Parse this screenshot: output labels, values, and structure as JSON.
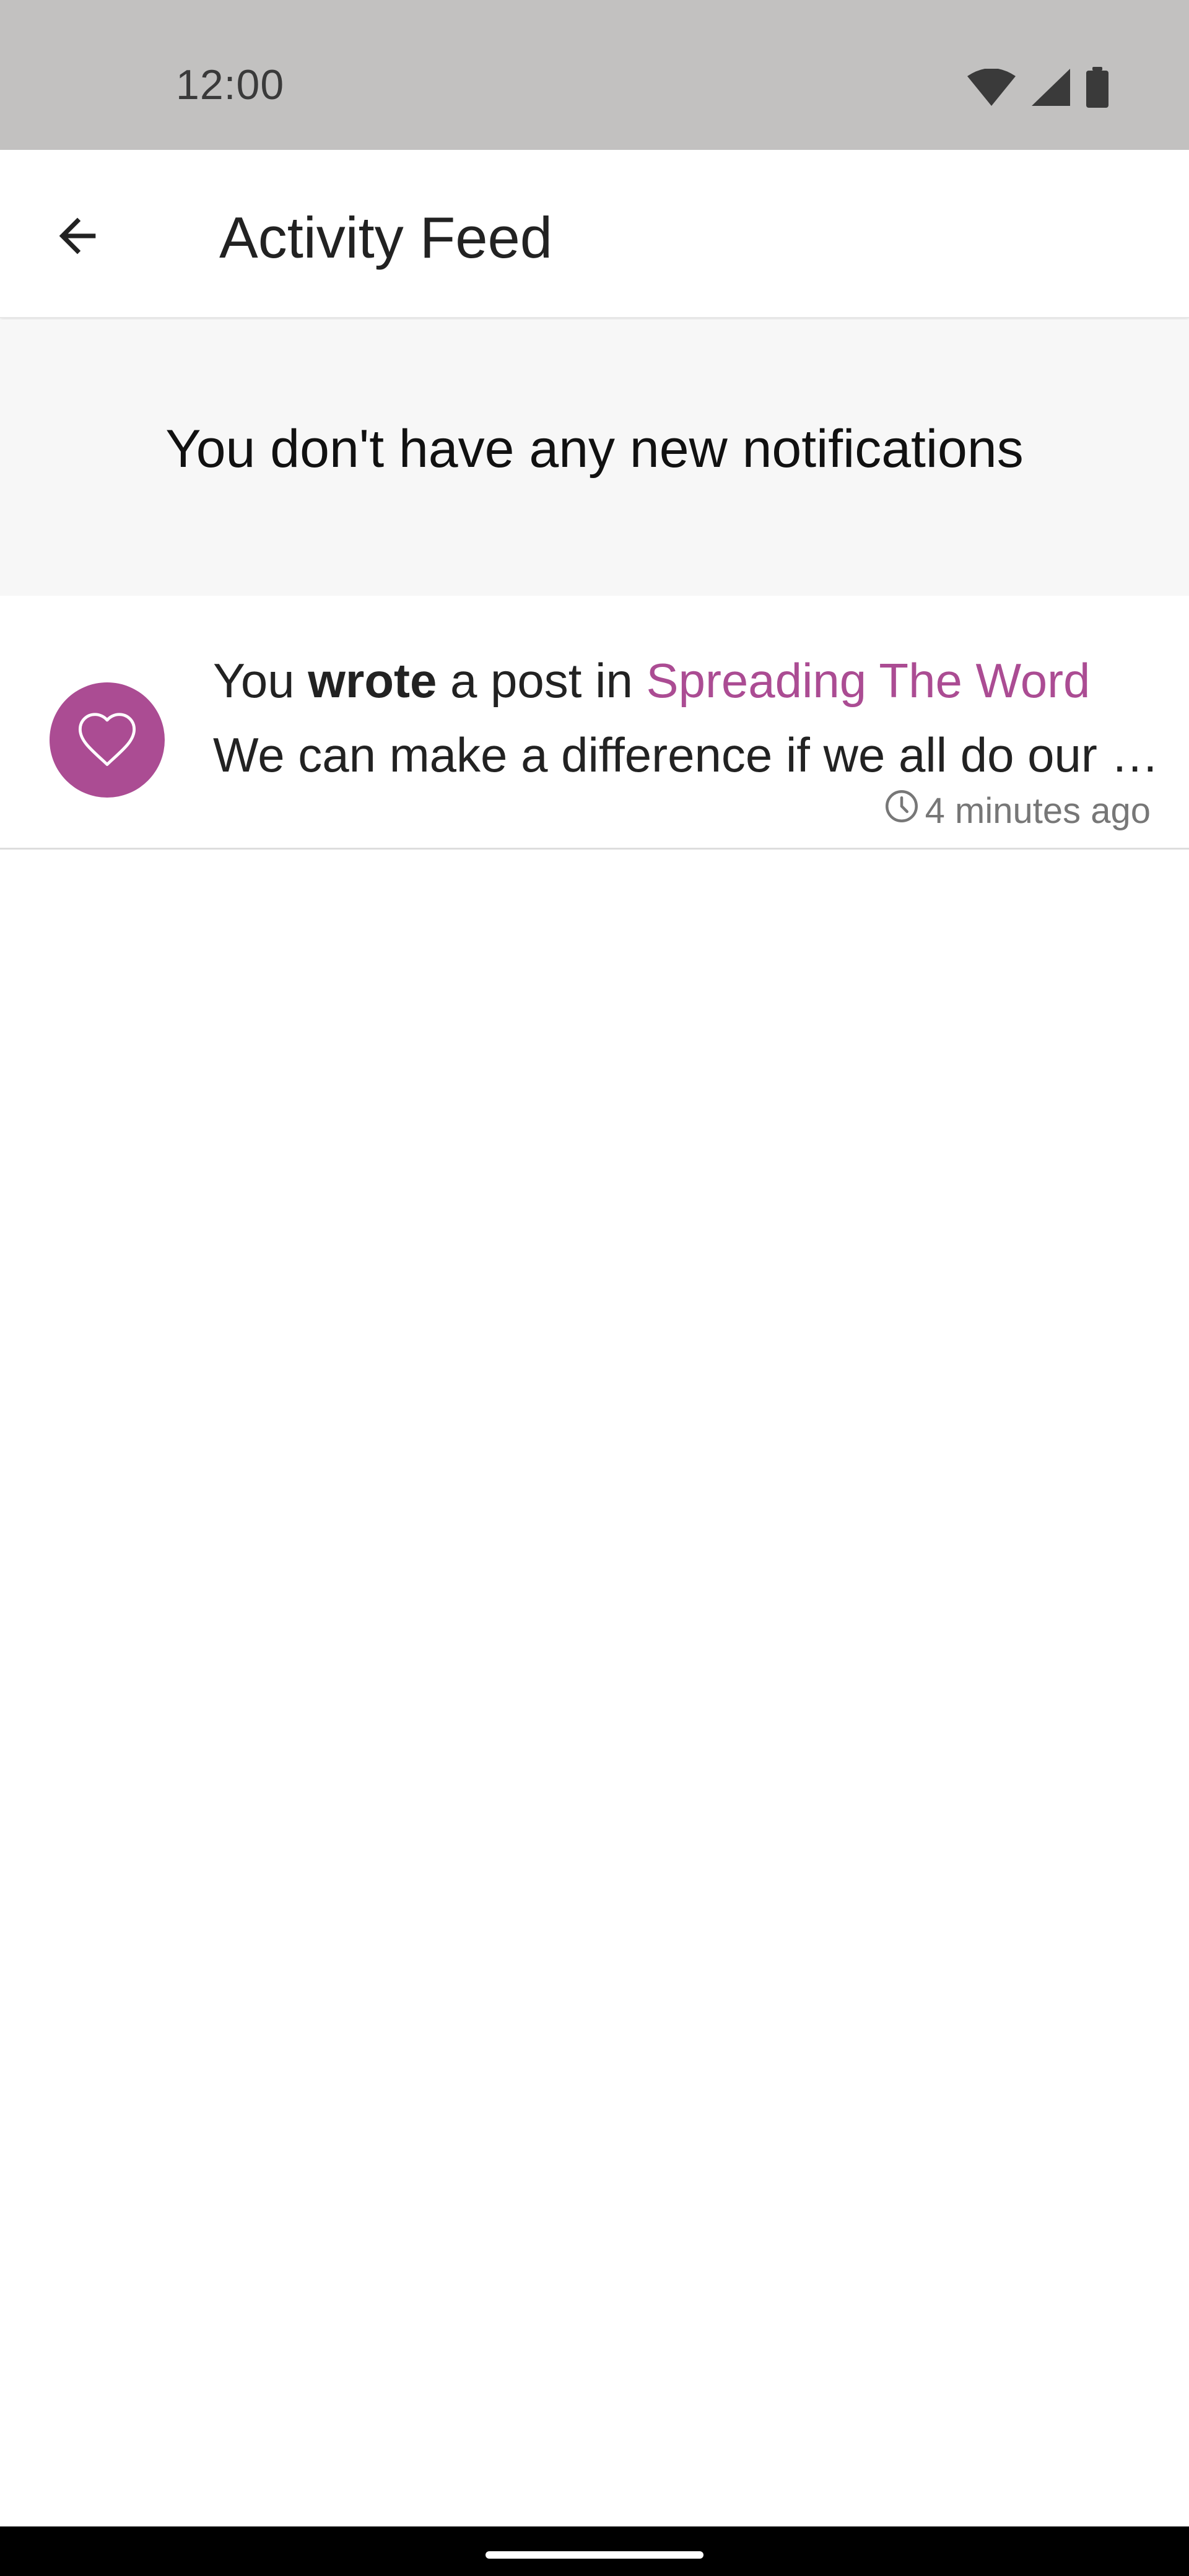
{
  "status_bar": {
    "time": "12:00",
    "icons": [
      "wifi-icon",
      "cell-signal-icon",
      "battery-icon"
    ]
  },
  "app_bar": {
    "back_icon": "arrow-back-icon",
    "title": "Activity Feed"
  },
  "banner": {
    "text": "You don't have any new notifications"
  },
  "feed": {
    "items": [
      {
        "icon": "heart-icon",
        "actor": "You",
        "action": "wrote",
        "connector": "a post in",
        "group": "Spreading The Word",
        "excerpt": "We can make a difference if we all do our part",
        "time_icon": "clock-icon",
        "time": "4 minutes ago"
      }
    ]
  },
  "colors": {
    "accent": "#ab4c93",
    "status_bar_bg": "#c2c1c0",
    "banner_bg": "#f7f7f7",
    "text": "#222222",
    "meta_text": "#777777"
  }
}
